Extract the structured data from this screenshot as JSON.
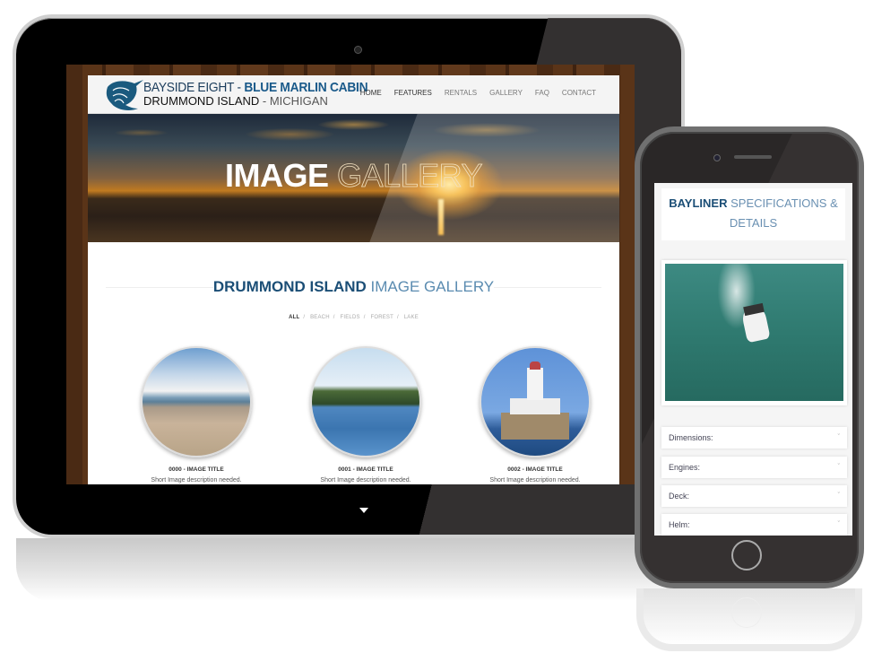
{
  "tablet": {
    "site": {
      "logo": {
        "line1_light": "BAYSIDE EIGHT - ",
        "line1_bold": "BLUE MARLIN CABIN",
        "line2_bold": "DRUMMOND ISLAND",
        "line2_light": " - MICHIGAN"
      },
      "nav": [
        "HOME",
        "FEATURES",
        "RENTALS",
        "GALLERY",
        "FAQ",
        "CONTACT"
      ],
      "hero": {
        "title_bold": "IMAGE",
        "title_light": " GALLERY"
      },
      "gallery": {
        "title_bold": "DRUMMOND ISLAND",
        "title_light": " IMAGE GALLERY",
        "filters": [
          "ALL",
          "BEACH",
          "FIELDS",
          "FOREST",
          "LAKE"
        ],
        "separator": "/",
        "items": [
          {
            "title": "0000 - IMAGE TITLE",
            "description": "Short Image description needed."
          },
          {
            "title": "0001 - IMAGE TITLE",
            "description": "Short Image description needed."
          },
          {
            "title": "0002 - IMAGE TITLE",
            "description": "Short Image description needed."
          }
        ]
      }
    }
  },
  "phone": {
    "heading_bold": "BAYLINER",
    "heading_light": " SPECIFICATIONS & DETAILS",
    "accordion": [
      {
        "label": "Dimensions:",
        "icon": "chevron-down-icon"
      },
      {
        "label": "Engines:",
        "icon": "chevron-down-icon"
      },
      {
        "label": "Deck:",
        "icon": "chevron-down-icon"
      },
      {
        "label": "Helm:",
        "icon": "chevron-down-icon"
      }
    ]
  },
  "icons": {
    "chevron": "ˇ",
    "scroll_down": "triangle-down"
  }
}
